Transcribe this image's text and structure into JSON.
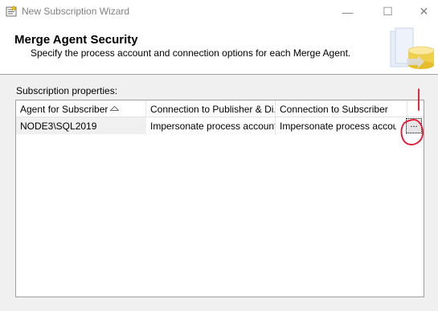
{
  "window": {
    "title": "New Subscription Wizard",
    "minimize_glyph": "—",
    "maximize_glyph": "☐",
    "close_glyph": "✕"
  },
  "header": {
    "title": "Merge Agent Security",
    "subtitle": "Specify the process account and connection options for each Merge Agent."
  },
  "subscription_properties": {
    "label": "Subscription properties:",
    "columns": [
      "Agent for Subscriber",
      "Connection to Publisher & Di...",
      "Connection to Subscriber",
      ""
    ],
    "rows": [
      {
        "agent": "NODE3\\SQL2019",
        "publisher_connection": "Impersonate process account",
        "subscriber_connection": "Impersonate process account",
        "button_label": "..."
      }
    ]
  },
  "colors": {
    "annotation_red": "#e8102c",
    "header_background": "#ffffff",
    "window_background": "#f0f0f0"
  },
  "icons": [
    "wizard-app-icon",
    "sort-ascending-icon",
    "database-arrow-graphic"
  ]
}
